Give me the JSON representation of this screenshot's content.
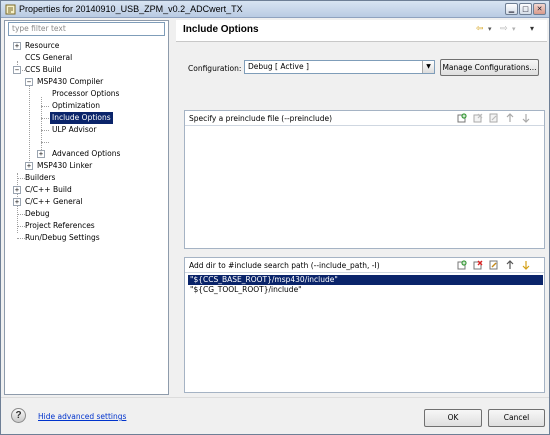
{
  "window": {
    "title": "Properties for 20140910_USB_ZPM_v0.2_ADCwert_TX",
    "buttons": [
      "minimize",
      "maximize",
      "close"
    ]
  },
  "filter": {
    "placeholder": "type filter text"
  },
  "tree": [
    {
      "label": "Resource",
      "expander": "+"
    },
    {
      "label": "CCS General"
    },
    {
      "label": "CCS Build",
      "expander": "−"
    },
    {
      "label": "MSP430 Compiler",
      "expander": "−"
    },
    {
      "label": "Processor Options"
    },
    {
      "label": "Optimization"
    },
    {
      "label": "Include Options",
      "selected": true
    },
    {
      "label": "ULP Advisor"
    },
    {
      "label": "Advanced Options",
      "expander": "+"
    },
    {
      "label": "MSP430 Linker",
      "expander": "+"
    },
    {
      "label": "Builders"
    },
    {
      "label": "C/C++ Build",
      "expander": "+"
    },
    {
      "label": "C/C++ General",
      "expander": "+"
    },
    {
      "label": "Debug"
    },
    {
      "label": "Project References"
    },
    {
      "label": "Run/Debug Settings"
    }
  ],
  "page": {
    "title": "Include Options",
    "nav": {
      "back": "⇦",
      "back_menu": "▾",
      "forward": "⇨",
      "forward_menu": "▾",
      "view_menu": "▾"
    }
  },
  "configuration": {
    "label": "Configuration:",
    "value": "Debug  [ Active ]",
    "manage_button": "Manage Configurations..."
  },
  "preinclude": {
    "title": "Specify a preinclude file (--preinclude)",
    "items": []
  },
  "include_path": {
    "title": "Add dir to #include search path (--include_path, -I)",
    "items": [
      {
        "text": "\"${CCS_BASE_ROOT}/msp430/include\"",
        "selected": true
      },
      {
        "text": "\"${CG_TOOL_ROOT}/include\"",
        "selected": false
      }
    ]
  },
  "toolbar_icons": [
    "add-icon",
    "delete-icon",
    "edit-icon",
    "move-up-icon",
    "move-down-icon"
  ],
  "footer": {
    "help": "?",
    "advanced_link": "Hide advanced settings",
    "ok": "OK",
    "cancel": "Cancel"
  },
  "colors": {
    "selection": "#0a246a",
    "link": "#0033cc",
    "title_gradient_top": "#d8e4f2"
  }
}
